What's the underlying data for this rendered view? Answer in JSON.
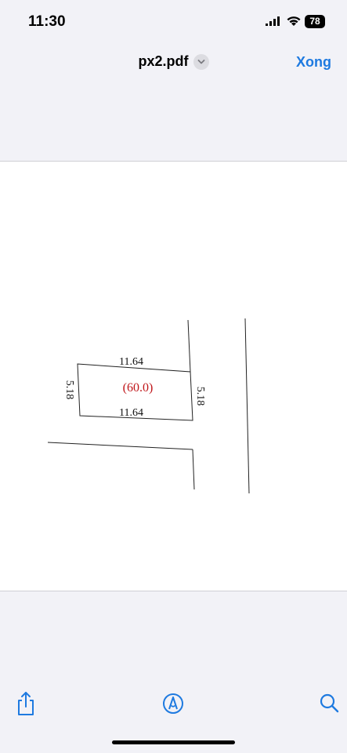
{
  "status_bar": {
    "time": "11:30",
    "battery": "78",
    "icons": [
      "signal-icon",
      "wifi-icon",
      "battery-icon"
    ]
  },
  "nav": {
    "title": "px2.pdf",
    "done_label": "Xong"
  },
  "plan": {
    "top_length": "11.64",
    "bottom_length": "11.64",
    "left_width": "5.18",
    "right_width": "5.18",
    "area": "(60.0)"
  },
  "toolbar": {
    "icons": [
      "share-icon",
      "markup-icon",
      "search-icon"
    ]
  },
  "colors": {
    "accent": "#1e7ae0",
    "area_text": "#c0161a",
    "background": "#f2f2f7"
  }
}
